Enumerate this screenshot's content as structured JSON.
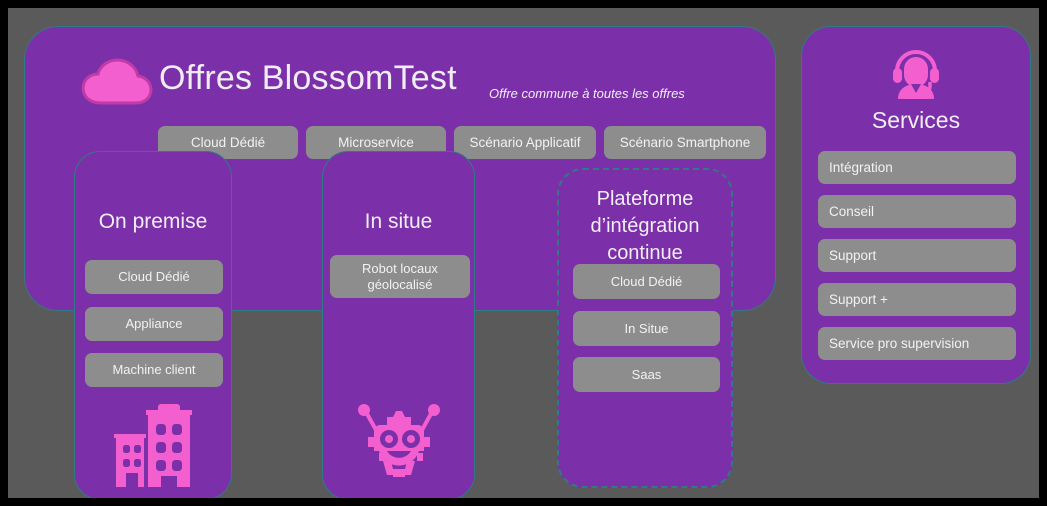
{
  "header": {
    "title": "Offres BlossomTest",
    "subtitle": "Offre commune à toutes les offres",
    "cloud_icon": "cloud-icon"
  },
  "chips": [
    {
      "label": "Cloud Dédié"
    },
    {
      "label": "Microservice"
    },
    {
      "label": "Scénario Applicatif"
    },
    {
      "label": "Scénario Smartphone"
    }
  ],
  "columns": [
    {
      "title": "On premise",
      "icon": "building-icon",
      "items": [
        {
          "label": "Cloud Dédié"
        },
        {
          "label": "Appliance"
        },
        {
          "label": "Machine client"
        }
      ]
    },
    {
      "title": "In situe",
      "icon": "robot-icon",
      "items": [
        {
          "label": "Robot locaux géolocalisé"
        }
      ]
    },
    {
      "title": "Plateforme d’intégration continue",
      "icon": "none",
      "items": [
        {
          "label": "Cloud Dédié"
        },
        {
          "label": "In Situe"
        },
        {
          "label": "Saas"
        }
      ]
    }
  ],
  "services": {
    "title": "Services",
    "icon": "headset-support-icon",
    "items": [
      {
        "label": "Intégration"
      },
      {
        "label": "Conseil"
      },
      {
        "label": "Support"
      },
      {
        "label": "Support  +"
      },
      {
        "label": "Service pro supervision"
      }
    ]
  },
  "colors": {
    "panel_purple": "#7b2fa8",
    "accent_pink": "#f45fd0",
    "outline_teal": "#2f7a86",
    "pill_gray": "#8d8d8d",
    "background_gray": "#5a5a5a",
    "frame_black": "#000000",
    "text_light": "#f0eef2"
  }
}
